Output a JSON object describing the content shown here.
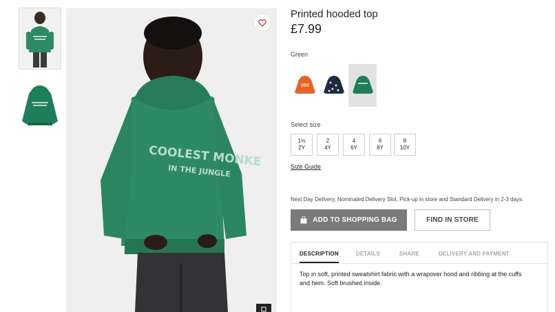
{
  "product": {
    "title": "Printed hooded top",
    "price": "£7.99",
    "color_label": "Green",
    "print_text": [
      "COOLEST MONKE",
      "IN THE JUNGLE"
    ]
  },
  "swatches": [
    {
      "name": "orange",
      "color": "#e2642c"
    },
    {
      "name": "navy",
      "color": "#1f2b40"
    },
    {
      "name": "green",
      "color": "#1f7e5a",
      "selected": true
    }
  ],
  "sizes": {
    "label": "Select size",
    "options": [
      {
        "label": "1½\n2Y"
      },
      {
        "label": "2\n4Y"
      },
      {
        "label": "4\n6Y"
      },
      {
        "label": "6\n8Y"
      },
      {
        "label": "8\n10Y"
      }
    ],
    "guide_label": "Size Guide"
  },
  "delivery_text": "Next Day Delivery, Nominated Delivery Slot, Pick-up in store and Standard Delivery in 2-3 days.",
  "buttons": {
    "add_to_bag": "ADD TO SHOPPING BAG",
    "find_in_store": "FIND IN STORE"
  },
  "tabs": [
    {
      "label": "DESCRIPTION",
      "active": true
    },
    {
      "label": "DETAILS"
    },
    {
      "label": "SHARE"
    },
    {
      "label": "DELIVERY AND PAYMENT"
    }
  ],
  "description": "Top in soft, printed sweatshirt fabric with a wrapover hood and ribbing at the cuffs and hem. Soft brushed inside.",
  "colors": {
    "hoodie_green": "#2e8a64",
    "print_color": "#b9dcc9",
    "button_grey": "#7a7a7a"
  },
  "icons": {
    "favourite": "heart-icon",
    "bag": "bag-icon",
    "zoom": "zoom-icon"
  }
}
